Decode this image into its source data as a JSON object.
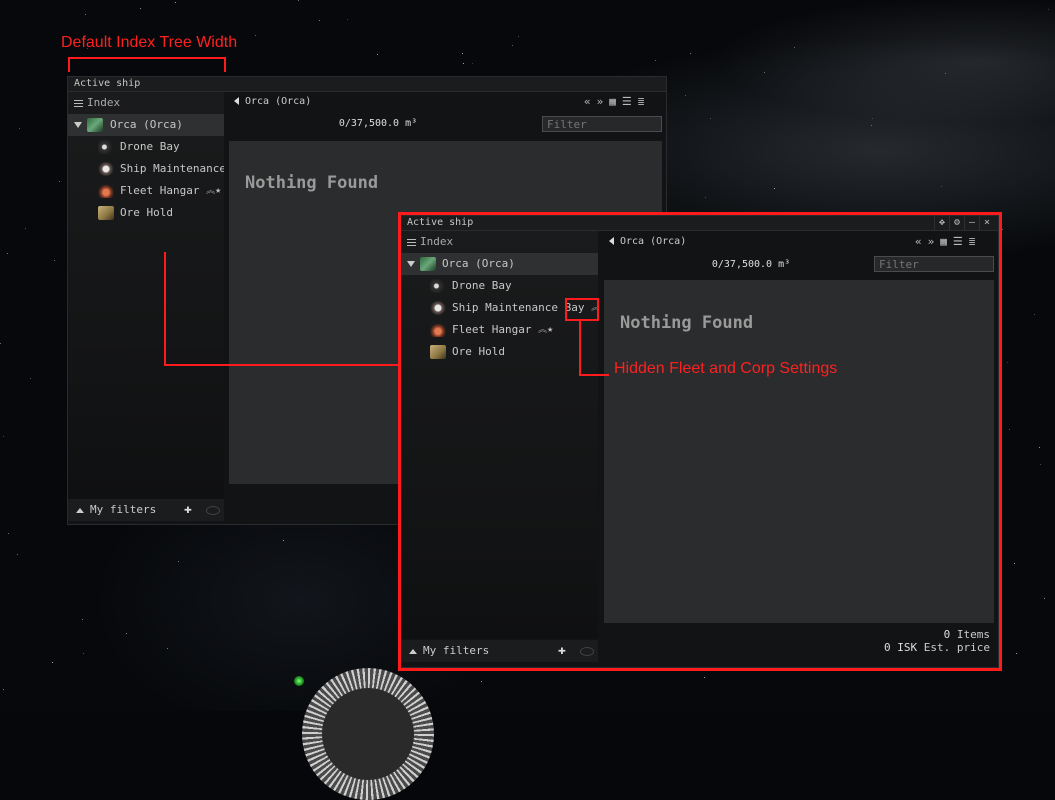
{
  "annotations": {
    "default_width_label": "Default Index Tree Width",
    "hidden_settings_label": "Hidden Fleet and Corp Settings"
  },
  "colors": {
    "annotation": "#ff1b1b",
    "selected_row": "#2f3031",
    "content_bg": "#2b2c2d"
  },
  "back_window": {
    "title": "Active ship",
    "index_label": "Index",
    "tree": [
      {
        "label": "Orca (Orca)",
        "icon": "ship-icon",
        "selected": true,
        "expanded": true
      },
      {
        "label": "Drone Bay",
        "icon": "drone-bay-icon"
      },
      {
        "label": "Ship Maintenance Ba",
        "icon": "ship-maintenance-icon"
      },
      {
        "label": "Fleet Hangar",
        "icon": "fleet-hangar-icon",
        "badges": [
          "fleet-chevron-icon",
          "corp-star-icon"
        ]
      },
      {
        "label": "Ore Hold",
        "icon": "ore-hold-icon"
      }
    ],
    "breadcrumb": "Orca (Orca)",
    "capacity": "0/37,500.0 m³",
    "filter_placeholder": "Filter",
    "empty_message": "Nothing Found",
    "footer_label": "My filters"
  },
  "front_window": {
    "title": "Active ship",
    "index_label": "Index",
    "tree": [
      {
        "label": "Orca (Orca)",
        "icon": "ship-icon",
        "selected": true,
        "expanded": true
      },
      {
        "label": "Drone Bay",
        "icon": "drone-bay-icon"
      },
      {
        "label": "Ship Maintenance Bay",
        "icon": "ship-maintenance-icon",
        "badges": [
          "fleet-chevron-icon",
          "corp-star-icon"
        ]
      },
      {
        "label": "Fleet Hangar",
        "icon": "fleet-hangar-icon",
        "badges": [
          "fleet-chevron-icon",
          "corp-star-icon"
        ]
      },
      {
        "label": "Ore Hold",
        "icon": "ore-hold-icon"
      }
    ],
    "breadcrumb": "Orca (Orca)",
    "capacity": "0/37,500.0 m³",
    "filter_placeholder": "Filter",
    "empty_message": "Nothing Found",
    "footer_label": "My filters",
    "items_count": "0",
    "items_label": "Items",
    "price_value": "0 ISK",
    "price_label": "Est. price"
  }
}
